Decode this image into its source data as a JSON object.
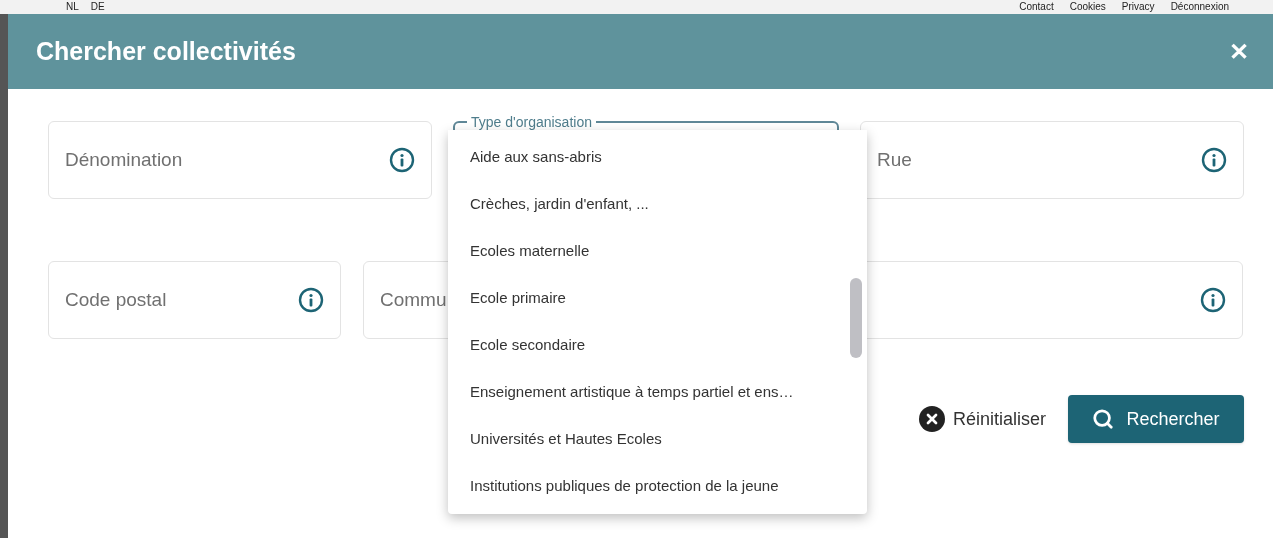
{
  "background_header": {
    "languages": [
      "NL",
      "DE"
    ],
    "links": [
      "Contact",
      "Cookies",
      "Privacy",
      "Déconnexion"
    ]
  },
  "dialog": {
    "title": "Chercher collectivités",
    "close_icon": "✕"
  },
  "fields_row_1": [
    {
      "kind": "text",
      "placeholder": "Dénomination"
    },
    {
      "kind": "select",
      "label": "Type d'organisation"
    },
    {
      "kind": "text",
      "placeholder": "Rue"
    }
  ],
  "fields_row_2": [
    {
      "kind": "text",
      "placeholder": "Code postal"
    },
    {
      "kind": "text",
      "placeholder": "Commu"
    },
    {
      "kind": "text"
    }
  ],
  "dropdown": {
    "options": [
      "Aide aux sans-abris",
      "Crèches, jardin d'enfant, ...",
      "Ecoles maternelle",
      "Ecole primaire",
      "Ecole secondaire",
      "Enseignement artistique à temps partiel et ens…",
      "Universités et Hautes Ecoles",
      "Institutions publiques de protection de la jeune"
    ]
  },
  "actions": {
    "reset": "Réinitialiser",
    "search": "Rechercher"
  }
}
